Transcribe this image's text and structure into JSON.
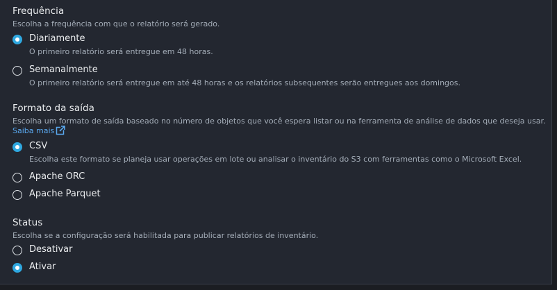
{
  "frequency": {
    "title": "Frequência",
    "description": "Escolha a frequência com que o relatório será gerado.",
    "options": [
      {
        "label": "Diariamente",
        "description": "O primeiro relatório será entregue em 48 horas.",
        "selected": true
      },
      {
        "label": "Semanalmente",
        "description": "O primeiro relatório será entregue em até 48 horas e os relatórios subsequentes serão entregues aos domingos.",
        "selected": false
      }
    ]
  },
  "output_format": {
    "title": "Formato da saída",
    "description": "Escolha um formato de saída baseado no número de objetos que você espera listar ou na ferramenta de análise de dados que deseja usar.",
    "learn_more": "Saiba mais",
    "learn_more_icon": "external-link-icon",
    "options": [
      {
        "label": "CSV",
        "description": "Escolha este formato se planeja usar operações em lote ou analisar o inventário do S3 com ferramentas como o Microsoft Excel.",
        "selected": true
      },
      {
        "label": "Apache ORC",
        "selected": false
      },
      {
        "label": "Apache Parquet",
        "selected": false
      }
    ]
  },
  "status": {
    "title": "Status",
    "description": "Escolha se a configuração será habilitada para publicar relatórios de inventário.",
    "options": [
      {
        "label": "Desativar",
        "selected": false
      },
      {
        "label": "Ativar",
        "selected": true
      }
    ]
  },
  "colors": {
    "background": "#232730",
    "radio_selected": "#2fa8e0",
    "link": "#5aa9f0",
    "text_primary": "#e9ebed",
    "text_secondary": "#a4adb8"
  }
}
